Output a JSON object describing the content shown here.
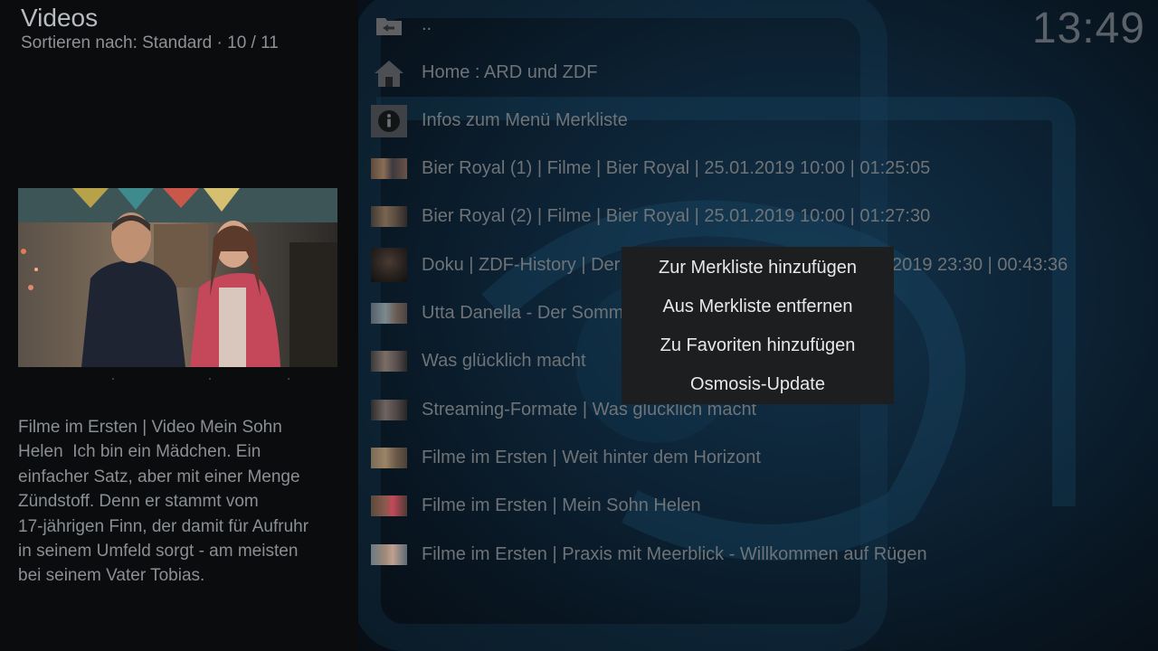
{
  "header": {
    "title": "Videos",
    "sort_line": "Sortieren nach: Standard  ·  10 / 11",
    "clock": "13:49"
  },
  "info_panel": {
    "plot": "Filme im Ersten | Video Mein Sohn\nHelen  Ich bin ein Mädchen. Ein\neinfacher Satz, aber mit einer Menge\nZündstoff. Denn er stammt vom\n17-jährigen Finn, der damit für Aufruhr\nin seinem Umfeld sorgt - am meisten\nbei seinem Vater Tobias."
  },
  "list": {
    "items": [
      {
        "label": "..",
        "icon": "folder-back-icon"
      },
      {
        "label": "Home : ARD und ZDF",
        "icon": "home-icon"
      },
      {
        "label": "Infos zum Menü Merkliste",
        "icon": "info-icon"
      },
      {
        "label": "Bier Royal (1) | Filme | Bier Royal | 25.01.2019 10:00 |  01:25:05",
        "icon": "video-thumbnail-icon"
      },
      {
        "label": "Bier Royal (2) | Filme | Bier Royal | 25.01.2019 10:00 |  01:27:30",
        "icon": "video-thumbnail-icon"
      },
      {
        "label": "Doku | ZDF-History | Der",
        "label_tail": "2019 23:30 |  00:43:36",
        "icon": "video-thumbnail-icon"
      },
      {
        "label": "Utta Danella - Der Somm",
        "icon": "video-thumbnail-icon"
      },
      {
        "label": "Was glücklich macht",
        "icon": "video-thumbnail-icon"
      },
      {
        "label": "Streaming-Formate | Was glücklich macht",
        "icon": "video-thumbnail-icon"
      },
      {
        "label": "Filme im Ersten | Weit hinter dem Horizont",
        "icon": "video-thumbnail-icon"
      },
      {
        "label": "Filme im Ersten | Mein Sohn Helen",
        "icon": "video-thumbnail-icon"
      },
      {
        "label": "Filme im Ersten | Praxis mit Meerblick - Willkommen auf Rügen",
        "icon": "video-thumbnail-icon"
      }
    ]
  },
  "context_menu": {
    "items": [
      "Zur Merkliste hinzufügen",
      "Aus Merkliste entfernen",
      "Zu Favoriten hinzufügen",
      "Osmosis-Update"
    ]
  },
  "colors": {
    "background": "#07090c",
    "list_text": "#6e7377",
    "menu_bg": "#1c1e20",
    "menu_text": "#e7e8e9"
  }
}
